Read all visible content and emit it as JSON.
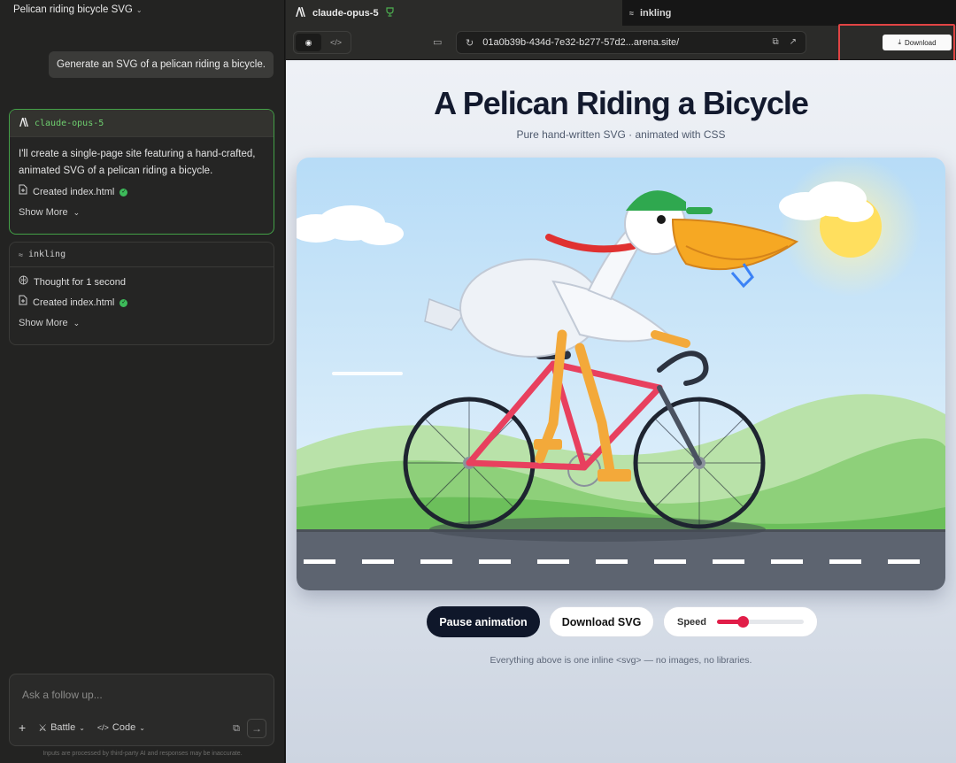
{
  "left_panel": {
    "chat_title": "Pelican riding bicycle SVG",
    "user_message": "Generate an SVG of a pelican riding a bicycle.",
    "responses": [
      {
        "model": "claude-opus-5",
        "text": "I'll create a single-page site featuring a hand-crafted, animated SVG of a pelican riding a bicycle.",
        "file": "Created index.html",
        "show_more": "Show More"
      },
      {
        "model": "inkling",
        "thought": "Thought for 1 second",
        "file": "Created index.html",
        "show_more": "Show More"
      }
    ],
    "composer": {
      "placeholder": "Ask a follow up...",
      "battle_label": "Battle",
      "code_label": "Code"
    },
    "disclaimer": "Inputs are processed by third-party AI and responses may be inaccurate."
  },
  "tabs": {
    "left": "claude-opus-5",
    "right": "inkling"
  },
  "address_bar": {
    "url": "01a0b39b-434d-7e32-b277-57d2...arena.site/",
    "download_label": "Download"
  },
  "preview": {
    "title": "A Pelican Riding a Bicycle",
    "subtitle": "Pure hand-written SVG · animated with CSS",
    "pause_label": "Pause animation",
    "download_svg_label": "Download SVG",
    "speed_label": "Speed",
    "speed_fraction": 0.3,
    "footnote": "Everything above is one inline <svg> — no images, no libraries."
  },
  "colors": {
    "accent_green": "#43a047",
    "highlight_red": "#e04444",
    "title_navy": "#131a2e",
    "slider_red": "#e11d48"
  }
}
